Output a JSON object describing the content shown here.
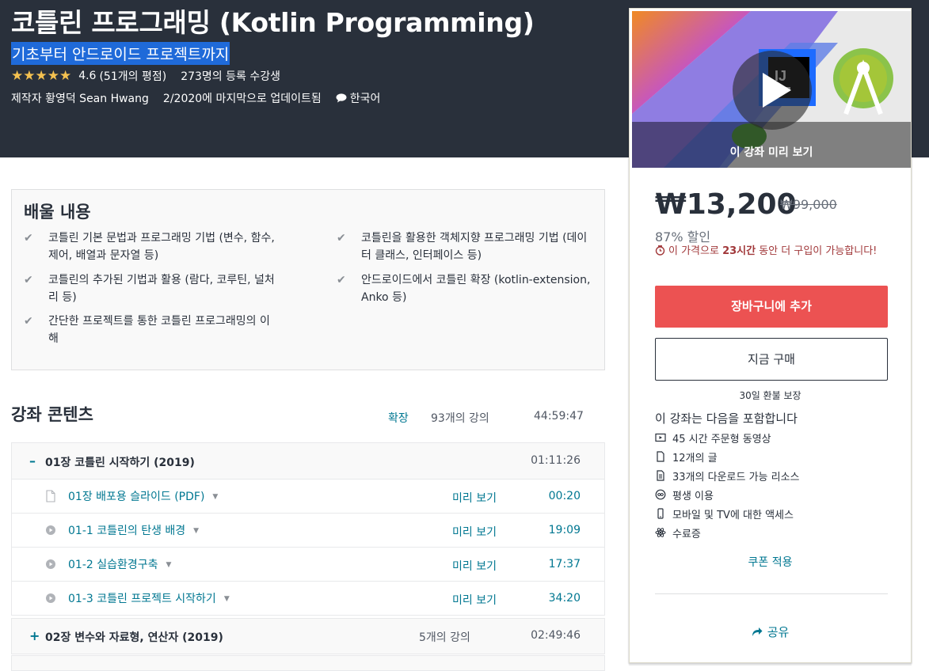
{
  "header": {
    "title": "코틀린 프로그래밍 (Kotlin Programming)",
    "subtitle": "기초부터 안드로이드 프로젝트까지",
    "stars": "★★★★★",
    "rating_value": "4.6",
    "rating_count": "(51개의 평점)",
    "enrolled": "273명의 등록 수강생",
    "author": "제작자 황영덕 Sean Hwang",
    "updated": "2/2020에 마지막으로 업데이트됨",
    "language": "한국어"
  },
  "sidebar": {
    "preview_label": "이 강좌 미리 보기",
    "preview_badge": "IJ",
    "price": "₩13,200",
    "old_price": "₩99,000",
    "discount": "87% 할인",
    "urgency_prefix": "이 가격으로 ",
    "urgency_bold": "23시간",
    "urgency_suffix": " 동안 더 구입이 가능합니다!",
    "add_to_cart": "장바구니에 추가",
    "buy_now": "지금 구매",
    "guarantee": "30일 환불 보장",
    "includes_title": "이 강좌는 다음을 포함합니다",
    "includes": [
      {
        "icon": "video-icon",
        "label": "45 시간 주문형 동영상"
      },
      {
        "icon": "file-icon",
        "label": "12개의 글"
      },
      {
        "icon": "download-file-icon",
        "label": "33개의 다운로드 가능 리소스"
      },
      {
        "icon": "infinity-icon",
        "label": "평생 이용"
      },
      {
        "icon": "mobile-icon",
        "label": "모바일 및 TV에 대한 액세스"
      },
      {
        "icon": "certificate-icon",
        "label": "수료증"
      }
    ],
    "coupon": "쿠폰 적용",
    "share": "공유"
  },
  "learn": {
    "title": "배울 내용",
    "items": [
      "코틀린 기본 문법과 프로그래밍 기법 (변수, 함수, 제어, 배열과 문자열 등)",
      "코틀린을 활용한 객체지향 프로그래밍 기법 (데이터 클래스, 인터페이스 등)",
      "코틀린의 추가된 기법과 활용 (람다, 코루틴, 널처리 등)",
      "안드로이드에서 코틀린 확장 (kotlin-extension, Anko 등)",
      "간단한 프로젝트를 통한 코틀린 프로그래밍의 이해"
    ]
  },
  "content": {
    "title": "강좌 콘텐츠",
    "expand": "확장",
    "lectures": "93개의 강의",
    "length": "44:59:47",
    "sections": [
      {
        "sign": "–",
        "name": "01장 코틀린 시작하기 (2019)",
        "count": "",
        "time": "01:11:26"
      },
      {
        "sign": "+",
        "name": "02장 변수와 자료형, 연산자 (2019)",
        "count": "5개의 강의",
        "time": "02:49:46"
      }
    ],
    "lecture_items": [
      {
        "icon": "document-icon",
        "name": "01장 배포용 슬라이드 (PDF)",
        "preview": "미리 보기",
        "time": "00:20"
      },
      {
        "icon": "play-icon",
        "name": "01-1 코틀린의 탄생 배경",
        "preview": "미리 보기",
        "time": "19:09"
      },
      {
        "icon": "play-icon",
        "name": "01-2 실습환경구축",
        "preview": "미리 보기",
        "time": "17:37"
      },
      {
        "icon": "play-icon",
        "name": "01-3 코틀린 프로젝트 시작하기",
        "preview": "미리 보기",
        "time": "34:20"
      }
    ]
  },
  "colors": {
    "hero_bg": "#29303b",
    "accent_link": "#007791",
    "cart_button": "#ec5252",
    "star": "#f4c150",
    "urgency": "#a1383a"
  }
}
